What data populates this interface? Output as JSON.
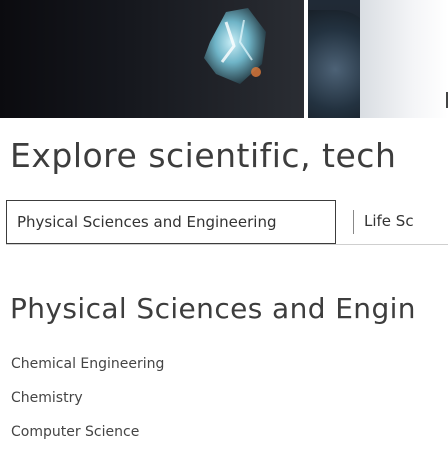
{
  "headline": "Explore scientific, tech",
  "tabs": [
    {
      "label": "Physical Sciences and Engineering",
      "active": true
    },
    {
      "label": "Life Sc",
      "active": false
    }
  ],
  "section_title": "Physical Sciences and Engin",
  "subjects": [
    {
      "label": "Chemical Engineering"
    },
    {
      "label": "Chemistry"
    },
    {
      "label": "Computer Science"
    }
  ],
  "colors": {
    "text": "#3c3c3c",
    "background": "#ffffff",
    "hero_dark": "#0b0b0f"
  }
}
